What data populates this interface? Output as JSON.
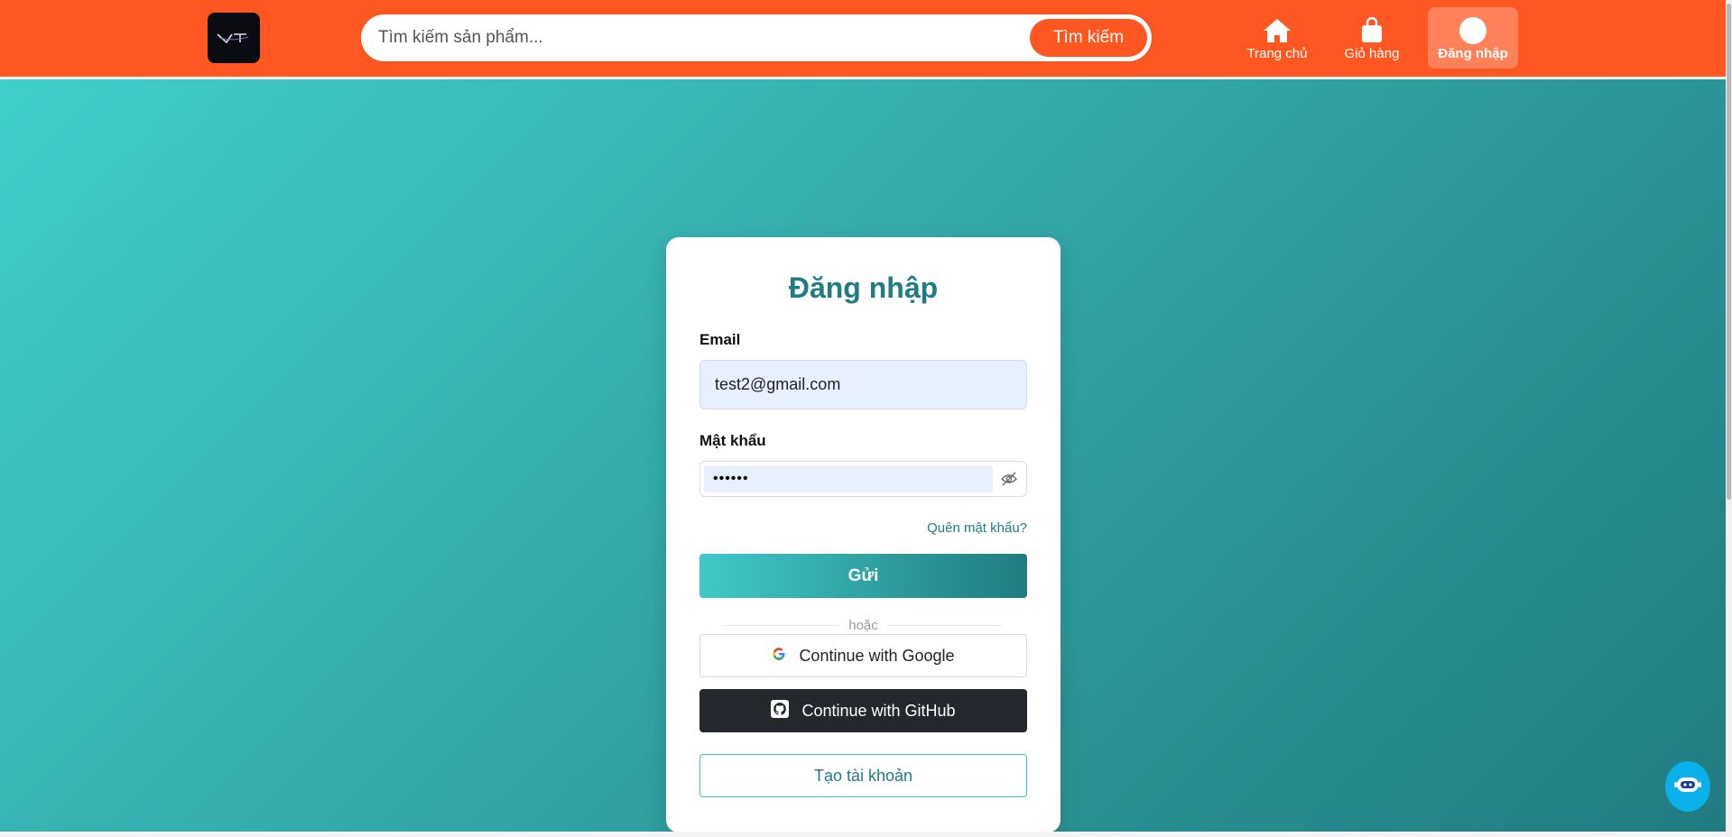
{
  "header": {
    "logo_text": "VCT",
    "search": {
      "placeholder": "Tìm kiếm sản phẩm...",
      "value": "",
      "button_label": "Tìm kiếm"
    },
    "nav": [
      {
        "label": "Trang chủ",
        "icon": "home-icon"
      },
      {
        "label": "Giỏ hàng",
        "icon": "shopping-bag-icon"
      },
      {
        "label": "Đăng nhập",
        "icon": "user-circle-icon"
      }
    ]
  },
  "login": {
    "title": "Đăng nhập",
    "email_label": "Email",
    "email_value": "test2@gmail.com",
    "password_label": "Mật khẩu",
    "password_value": "123456",
    "forgot_label": "Quên mật khẩu?",
    "submit_label": "Gửi",
    "divider_label": "hoặc",
    "google_label": "Continue with Google",
    "github_label": "Continue with GitHub",
    "create_label": "Tạo tài khoản"
  },
  "colors": {
    "header": "#ff5722",
    "accent": "#1f7c80",
    "gradient_start": "#40cfcc",
    "gradient_end": "#217b80"
  }
}
